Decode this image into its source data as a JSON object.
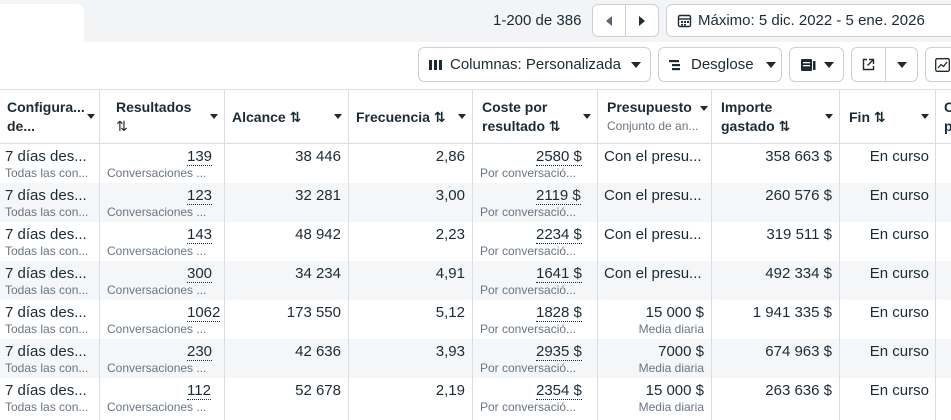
{
  "pagination": {
    "text": "1-200 de 386"
  },
  "date_range": {
    "label": "Máximo: 5 dic. 2022 - 5 ene. 2026"
  },
  "toolbar": {
    "columns_label": "Columnas: Personalizada",
    "breakdown_label": "Desglose"
  },
  "columns": [
    {
      "l1": "Configura...",
      "l2": "de..."
    },
    {
      "l1": "Resultados",
      "l2": "⇅"
    },
    {
      "l1": "Alcance ⇅"
    },
    {
      "l1": "Frecuencia ⇅"
    },
    {
      "l1": "Coste por",
      "l2": "resultado ⇅"
    },
    {
      "l1": "Presupuesto",
      "sub": "Conjunto de an..."
    },
    {
      "l1": "Importe",
      "l2": "gastado ⇅"
    },
    {
      "l1": "Fin ⇅"
    },
    {
      "l1": "C",
      "l2": "p"
    }
  ],
  "rows": [
    {
      "config": "7 días des...",
      "config_sub": "Todas las con...",
      "results": "139",
      "results_sub": "Conversaciones ...",
      "reach": "38 446",
      "frequency": "2,86",
      "cost": "2580 $",
      "cost_sub": "Por conversació...",
      "budget": "Con el presu...",
      "budget_sub": "",
      "spent": "358 663 $",
      "end": "En curso"
    },
    {
      "config": "7 días des...",
      "config_sub": "Todas las con...",
      "results": "123",
      "results_sub": "Conversaciones ...",
      "reach": "32 281",
      "frequency": "3,00",
      "cost": "2119 $",
      "cost_sub": "Por conversació...",
      "budget": "Con el presu...",
      "budget_sub": "",
      "spent": "260 576 $",
      "end": "En curso"
    },
    {
      "config": "7 días des...",
      "config_sub": "Todas las con...",
      "results": "143",
      "results_sub": "Conversaciones ...",
      "reach": "48 942",
      "frequency": "2,23",
      "cost": "2234 $",
      "cost_sub": "Por conversació...",
      "budget": "Con el presu...",
      "budget_sub": "",
      "spent": "319 511 $",
      "end": "En curso"
    },
    {
      "config": "7 días des...",
      "config_sub": "Todas las con...",
      "results": "300",
      "results_sub": "Conversaciones ...",
      "reach": "34 234",
      "frequency": "4,91",
      "cost": "1641 $",
      "cost_sub": "Por conversació...",
      "budget": "Con el presu...",
      "budget_sub": "",
      "spent": "492 334 $",
      "end": "En curso"
    },
    {
      "config": "7 días des...",
      "config_sub": "Todas las con...",
      "results": "1062",
      "results_sub": "Conversaciones ...",
      "reach": "173 550",
      "frequency": "5,12",
      "cost": "1828 $",
      "cost_sub": "Por conversació...",
      "budget": "15 000 $",
      "budget_sub": "Media diaria",
      "spent": "1 941 335 $",
      "end": "En curso"
    },
    {
      "config": "7 días des...",
      "config_sub": "Todas las con...",
      "results": "230",
      "results_sub": "Conversaciones ...",
      "reach": "42 636",
      "frequency": "3,93",
      "cost": "2935 $",
      "cost_sub": "Por conversació...",
      "budget": "7000 $",
      "budget_sub": "Media diaria",
      "spent": "674 963 $",
      "end": "En curso"
    },
    {
      "config": "7 días des...",
      "config_sub": "Todas las con...",
      "results": "112",
      "results_sub": "Conversaciones ...",
      "reach": "52 678",
      "frequency": "2,19",
      "cost": "2354 $",
      "cost_sub": "Por conversació...",
      "budget": "15 000 $",
      "budget_sub": "Media diaria",
      "spent": "263 636 $",
      "end": "En curso"
    }
  ]
}
